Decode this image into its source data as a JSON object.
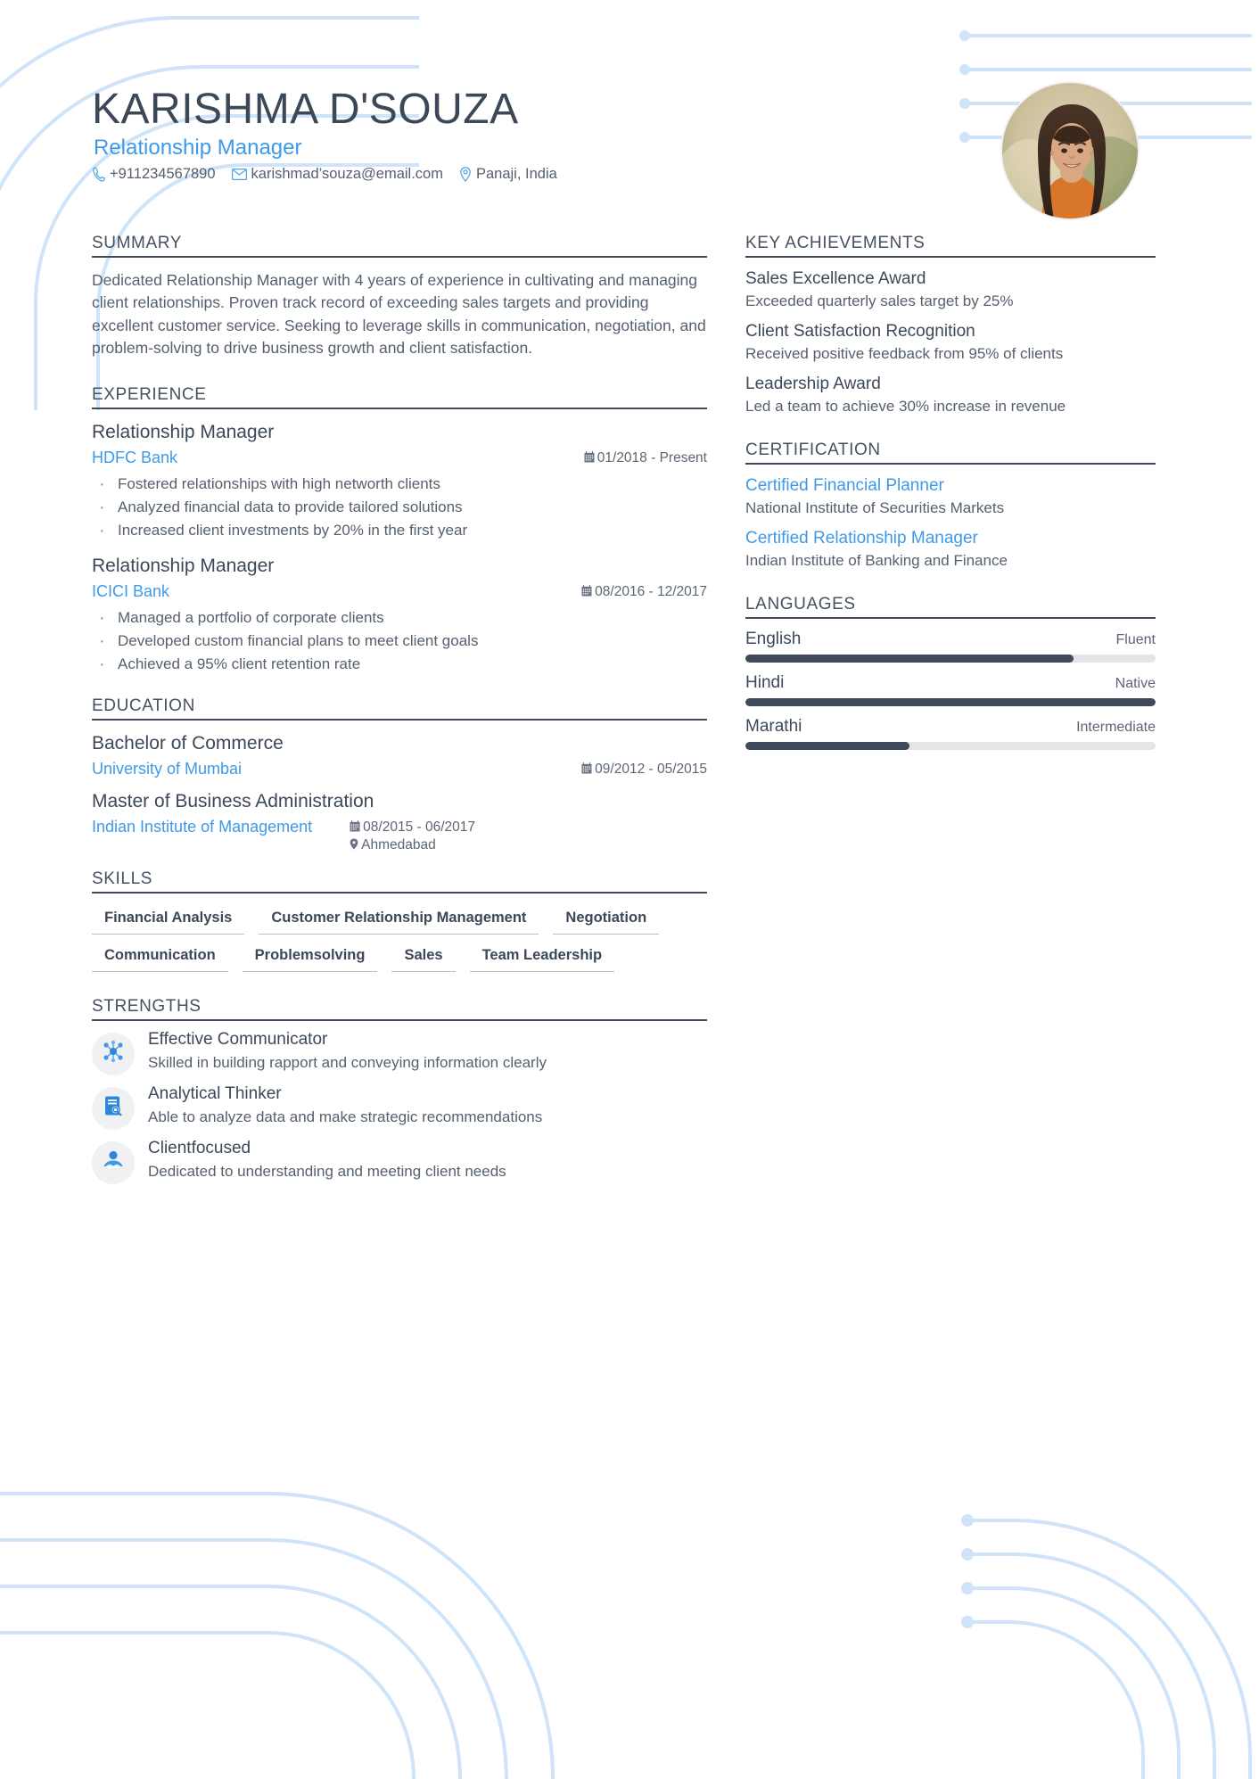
{
  "document_type": "resume",
  "header": {
    "name": "KARISHMA D'SOUZA",
    "job_title": "Relationship Manager",
    "contacts": [
      {
        "icon": "phone-icon",
        "glyph": "✆",
        "value": "+911234567890"
      },
      {
        "icon": "envelope-icon",
        "glyph": "✉",
        "value": "karishmad’souza@email.com"
      },
      {
        "icon": "location-pin-icon",
        "glyph": "◎",
        "value": "Panaji, India"
      }
    ],
    "avatar_alt": "portrait photo"
  },
  "left": {
    "summary": {
      "heading": "SUMMARY",
      "text": "Dedicated Relationship Manager with 4 years of experience in cultivating and managing client relationships. Proven track record of exceeding sales targets and providing excellent customer service. Seeking to leverage skills in communication, negotiation, and problem-solving to drive business growth and client satisfaction."
    },
    "experience": {
      "heading": "EXPERIENCE",
      "entries": [
        {
          "role": "Relationship Manager",
          "org": "HDFC Bank",
          "dates": "01/2018 - Present",
          "bullets": [
            "Fostered relationships with high networth clients",
            "Analyzed financial data to provide tailored solutions",
            "Increased client investments by 20% in the first year"
          ]
        },
        {
          "role": "Relationship Manager",
          "org": "ICICI Bank",
          "dates": "08/2016 - 12/2017",
          "bullets": [
            "Managed a portfolio of corporate clients",
            "Developed custom financial plans to meet client goals",
            "Achieved a 95% client retention rate"
          ]
        }
      ]
    },
    "education": {
      "heading": "EDUCATION",
      "entries": [
        {
          "degree": "Bachelor of Commerce",
          "school": "University of Mumbai",
          "dates": "09/2012 - 05/2015",
          "location": ""
        },
        {
          "degree": "Master of Business Administration",
          "school": "Indian Institute of Management",
          "dates": "08/2015 - 06/2017",
          "location": "Ahmedabad"
        }
      ]
    },
    "skills": {
      "heading": "SKILLS",
      "items": [
        "Financial Analysis",
        "Customer Relationship Management",
        "Negotiation",
        "Communication",
        "Problemsolving",
        "Sales",
        "Team Leadership"
      ]
    },
    "strengths": {
      "heading": "STRENGTHS",
      "items": [
        {
          "icon": "network-nodes-icon",
          "title": "Effective Communicator",
          "desc": "Skilled in building rapport and conveying information clearly"
        },
        {
          "icon": "document-search-icon",
          "title": "Analytical Thinker",
          "desc": "Able to analyze data and make strategic recommendations"
        },
        {
          "icon": "handshake-icon",
          "title": "Clientfocused",
          "desc": "Dedicated to understanding and meeting client needs"
        }
      ]
    }
  },
  "right": {
    "achievements": {
      "heading": "KEY ACHIEVEMENTS",
      "items": [
        {
          "title": "Sales Excellence Award",
          "desc": "Exceeded quarterly sales target by 25%"
        },
        {
          "title": "Client Satisfaction Recognition",
          "desc": "Received positive feedback from 95% of clients"
        },
        {
          "title": "Leadership Award",
          "desc": "Led a team to achieve 30% increase in revenue"
        }
      ]
    },
    "certification": {
      "heading": "CERTIFICATION",
      "items": [
        {
          "name": "Certified Financial Planner",
          "org": "National Institute of Securities Markets"
        },
        {
          "name": "Certified Relationship Manager",
          "org": "Indian Institute of Banking and Finance"
        }
      ]
    },
    "languages": {
      "heading": "LANGUAGES",
      "items": [
        {
          "name": "English",
          "level": "Fluent",
          "percent": 80
        },
        {
          "name": "Hindi",
          "level": "Native",
          "percent": 100
        },
        {
          "name": "Marathi",
          "level": "Intermediate",
          "percent": 40
        }
      ]
    }
  },
  "colors": {
    "accent_blue": "#3e9ae8",
    "dark_slate": "#3f4b5b",
    "body_text": "#55606e",
    "deco_line": "#cfe4f9",
    "track": "#e4e5e7"
  }
}
